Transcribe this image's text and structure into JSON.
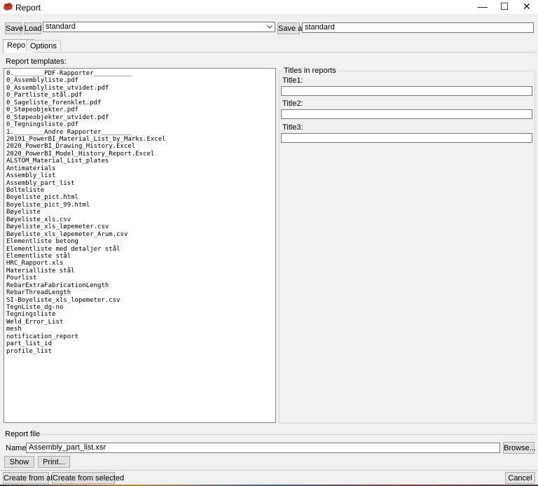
{
  "window": {
    "title": "Report",
    "minimize_glyph": "—",
    "maximize_glyph": "☐",
    "close_glyph": "✕"
  },
  "toolbar": {
    "save_label": "Save",
    "load_label": "Load",
    "load_value": "standard",
    "save_as_label": "Save as",
    "save_as_value": "standard"
  },
  "tabs": [
    {
      "label": "Report",
      "active": true
    },
    {
      "label": "Options",
      "active": false
    }
  ],
  "templates": {
    "label": "Report templates:",
    "items": [
      "0.________PDF-Rapporter__________",
      "0_Assemblyliste.pdf",
      "0_Assemblyliste_utvidet.pdf",
      "0_Partliste_stål.pdf",
      "0_Sageliste_forenklet.pdf",
      "0_Støpeobjekter.pdf",
      "0_Støpeobjekter_utvidet.pdf",
      "0_Tegningsliste.pdf",
      "1.________Andre Rapporter________",
      "20191_PowerBI_Material_List_by_Marks.Excel",
      "2020_PowerBI_Drawing_History.Excel",
      "2020_PowerBI_Model_History_Report.Excel",
      "ALSTOM_Material_List_plates",
      "Antimaterials",
      "Assembly_list",
      "Assembly_part_list",
      "Bolteliste",
      "Boyeliste_pict.html",
      "Boyeliste_pict_99.html",
      "Bøyeliste",
      "Bøyeliste_xls.csv",
      "Bøyeliste_xls_løpemeter.csv",
      "Bøyeliste_xls_løpemeter_Arum.csv",
      "Elementliste betong",
      "Elementliste med detaljer stål",
      "Elementliste stål",
      "HRC_Rapport.xls",
      "Materialliste stål",
      "Pourlist",
      "RebarExtraFabricationLength",
      "RebarThreadLength",
      "SI-Boyeliste_xls_lopemeter.csv",
      "TegnListe_dg-no",
      "Tegningsliste",
      "Weld_Error_List",
      "mesh",
      "notification_report",
      "part_list_id",
      "profile_list"
    ]
  },
  "titles": {
    "group_label": "Titles in reports",
    "title1_label": "Title1:",
    "title1_value": "",
    "title2_label": "Title2:",
    "title2_value": "",
    "title3_label": "Title3:",
    "title3_value": ""
  },
  "report_file": {
    "group_label": "Report file",
    "name_label": "Name:",
    "name_value": "Assembly_part_list.xsr",
    "browse_label": "Browse...",
    "show_label": "Show",
    "print_label": "Print..."
  },
  "footer": {
    "create_all_label": "Create from all",
    "create_selected_label": "Create from selected",
    "cancel_label": "Cancel"
  },
  "icons": {
    "app": "report-app-icon",
    "dropdown": "chevron-down-icon"
  },
  "colors": {
    "app_icon": "#c0392b"
  }
}
